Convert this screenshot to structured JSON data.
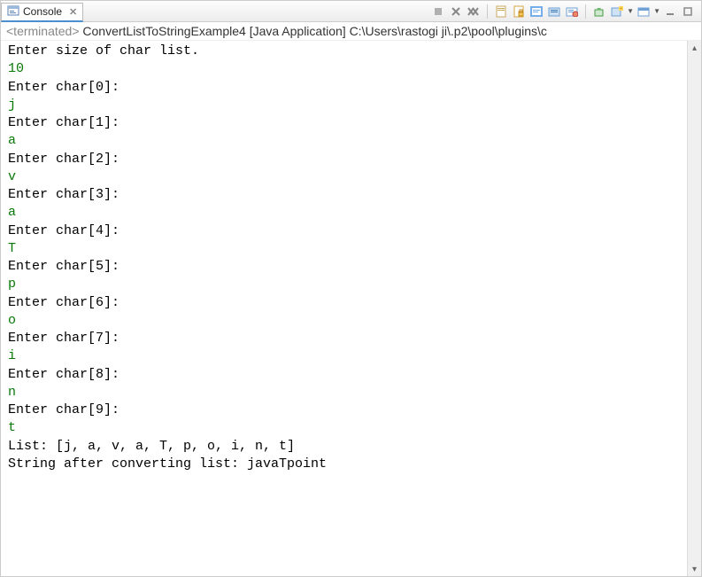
{
  "tab": {
    "title": "Console"
  },
  "subtitle": {
    "status": "<terminated>",
    "name": "ConvertListToStringExample4",
    "type": "[Java Application]",
    "path": "C:\\Users\\rastogi ji\\.p2\\pool\\plugins\\c"
  },
  "toolbar": {
    "icons": [
      "terminate-icon",
      "remove-launch-icon",
      "remove-all-icon",
      "clear-icon",
      "scroll-lock-icon",
      "word-wrap-icon",
      "pin-icon",
      "display-selected-icon",
      "open-console-icon",
      "new-console-icon",
      "select-console-icon",
      "minimize-icon",
      "maximize-icon"
    ]
  },
  "console": {
    "lines": [
      {
        "kind": "out",
        "text": "Enter size of char list."
      },
      {
        "kind": "in",
        "text": "10"
      },
      {
        "kind": "out",
        "text": "Enter char[0]:"
      },
      {
        "kind": "in",
        "text": "j"
      },
      {
        "kind": "out",
        "text": "Enter char[1]:"
      },
      {
        "kind": "in",
        "text": "a"
      },
      {
        "kind": "out",
        "text": "Enter char[2]:"
      },
      {
        "kind": "in",
        "text": "v"
      },
      {
        "kind": "out",
        "text": "Enter char[3]:"
      },
      {
        "kind": "in",
        "text": "a"
      },
      {
        "kind": "out",
        "text": "Enter char[4]:"
      },
      {
        "kind": "in",
        "text": "T"
      },
      {
        "kind": "out",
        "text": "Enter char[5]:"
      },
      {
        "kind": "in",
        "text": "p"
      },
      {
        "kind": "out",
        "text": "Enter char[6]:"
      },
      {
        "kind": "in",
        "text": "o"
      },
      {
        "kind": "out",
        "text": "Enter char[7]:"
      },
      {
        "kind": "in",
        "text": "i"
      },
      {
        "kind": "out",
        "text": "Enter char[8]:"
      },
      {
        "kind": "in",
        "text": "n"
      },
      {
        "kind": "out",
        "text": "Enter char[9]:"
      },
      {
        "kind": "in",
        "text": "t"
      },
      {
        "kind": "out",
        "text": "List: [j, a, v, a, T, p, o, i, n, t]"
      },
      {
        "kind": "out",
        "text": "String after converting list: javaTpoint"
      }
    ]
  }
}
